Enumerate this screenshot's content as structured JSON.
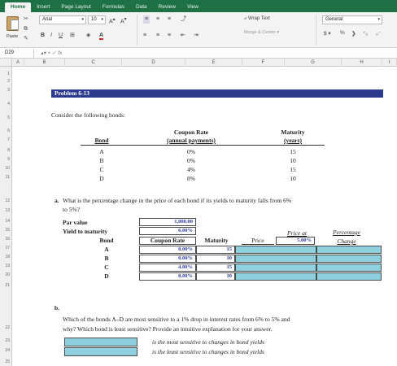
{
  "ribbon": {
    "tabs": [
      "Home",
      "Insert",
      "Page Layout",
      "Formulas",
      "Data",
      "Review",
      "View"
    ],
    "active_tab": "Home",
    "paste_label": "Paste",
    "font_name": "Arial",
    "font_size": "10",
    "wrap_text": "Wrap Text",
    "merge_center": "Merge & Center",
    "number_format": "General"
  },
  "formula_bar": {
    "name_box": "D29",
    "fx": "fx",
    "formula": ""
  },
  "columns": [
    "A",
    "B",
    "C",
    "D",
    "E",
    "F",
    "G",
    "H",
    "I"
  ],
  "rows": [
    "1",
    "2",
    "3",
    "4",
    "5",
    "6",
    "7",
    "8",
    "9",
    "10",
    "11",
    "12",
    "13",
    "14",
    "15",
    "16",
    "17",
    "18",
    "19",
    "20",
    "21",
    "22",
    "23",
    "24",
    "25"
  ],
  "sheet": {
    "title": "Problem 6-13",
    "intro": "Consider the following bonds:",
    "bond_table": {
      "header_coupon_line1": "Coupon Rate",
      "header_coupon_line2": "(annual payments)",
      "header_maturity_line1": "Maturity",
      "header_maturity_line2": "(years)",
      "header_bond": "Bond",
      "rows": [
        {
          "bond": "A",
          "coupon": "0%",
          "maturity": "15"
        },
        {
          "bond": "B",
          "coupon": "0%",
          "maturity": "10"
        },
        {
          "bond": "C",
          "coupon": "4%",
          "maturity": "15"
        },
        {
          "bond": "D",
          "coupon": "8%",
          "maturity": "10"
        }
      ]
    },
    "part_a": {
      "label": "a.",
      "question_line1": "What is the percentage change in the price of each bond if its yields to maturity falls from 6%",
      "question_line2": "to 5%?",
      "par_label": "Par value",
      "par_value": "1,000.00",
      "ytm_label": "Yield to maturity",
      "ytm_value": "6.00%",
      "price_at_label": "Price at",
      "price_at_value": "5.00%",
      "pct_label_line1": "Percentage",
      "pct_label_line2": "Change",
      "headers": {
        "bond": "Bond",
        "coupon": "Coupon Rate",
        "maturity": "Maturity",
        "price": "Price"
      },
      "rows": [
        {
          "bond": "A",
          "coupon": "0.00%",
          "maturity": "15"
        },
        {
          "bond": "B",
          "coupon": "0.00%",
          "maturity": "10"
        },
        {
          "bond": "C",
          "coupon": "4.00%",
          "maturity": "15"
        },
        {
          "bond": "D",
          "coupon": "8.00%",
          "maturity": "10"
        }
      ]
    },
    "part_b": {
      "label": "b.",
      "question_line1": "Which of the bonds A–D are most sensitive to a 1% drop in interest rates from 6% to 5% and",
      "question_line2": "why? Which bond is least sensitive? Provide an intuitive explanation for your answer.",
      "most_text": "is the most sensitive to changes in bond yields",
      "least_text": "is the least sensitive to changes in bond yields"
    }
  },
  "colors": {
    "ribbon_green": "#1e7145",
    "title_bar": "#2d3b8f",
    "input_teal": "#8fd0de",
    "input_blue_text": "#2b3a9c"
  }
}
